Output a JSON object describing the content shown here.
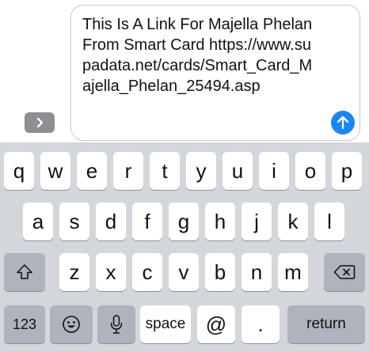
{
  "compose": {
    "message_text": "This Is A Link For Majella Phelan From Smart Card https://www.supadata.net/cards/Smart_Card_Majella_Phelan_25494.asp",
    "expand_icon": "chevron-right-icon",
    "send_icon": "arrow-up-icon"
  },
  "keyboard": {
    "row1": [
      "q",
      "w",
      "e",
      "r",
      "t",
      "y",
      "u",
      "i",
      "o",
      "p"
    ],
    "row2": [
      "a",
      "s",
      "d",
      "f",
      "g",
      "h",
      "j",
      "k",
      "l"
    ],
    "row3": [
      "z",
      "x",
      "c",
      "v",
      "b",
      "n",
      "m"
    ],
    "shift_icon": "shift-icon",
    "delete_icon": "delete-icon",
    "numbers_label": "123",
    "emoji_icon": "emoji-icon",
    "mic_icon": "microphone-icon",
    "space_label": "space",
    "at_label": "@",
    "period_label": ".",
    "return_label": "return"
  },
  "colors": {
    "keyboard_bg": "#d3d6db",
    "key_bg": "#ffffff",
    "special_key_bg": "#aeb3bd",
    "send_button": "#1a86f5"
  }
}
